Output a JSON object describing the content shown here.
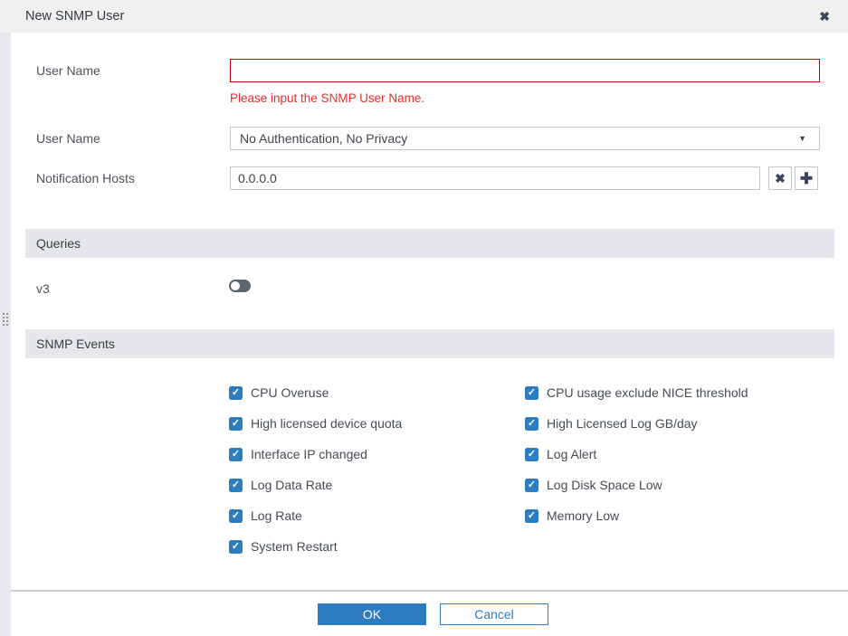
{
  "colors": {
    "accent_blue": "#2d7cc0",
    "checkbox_blue": "#2d7dc1",
    "error_text_red": "#e62e2a",
    "error_border_red": "#c40000",
    "titlebar_gray": "#f0f0f1",
    "section_bar_gray": "#e5e7ea",
    "toggle_off_gray": "#5c6470"
  },
  "icons": {
    "close": "✖",
    "plus": "✚",
    "caret_down": "▼",
    "check": "✓"
  },
  "titlebar": {
    "title": "New SNMP User"
  },
  "form": {
    "username": {
      "label": "User Name",
      "value": "",
      "error": "Please input the SNMP User Name."
    },
    "security_level": {
      "label": "User Name",
      "value": "No Authentication, No Privacy"
    },
    "notification_hosts": {
      "label": "Notification Hosts",
      "value": "0.0.0.0"
    }
  },
  "sections": {
    "queries": {
      "header": "Queries",
      "v3_label": "v3",
      "v3_enabled": false
    },
    "snmp_events": {
      "header": "SNMP Events",
      "left": [
        {
          "label": "CPU Overuse",
          "checked": true
        },
        {
          "label": "High licensed device quota",
          "checked": true
        },
        {
          "label": "Interface IP changed",
          "checked": true
        },
        {
          "label": "Log Data Rate",
          "checked": true
        },
        {
          "label": "Log Rate",
          "checked": true
        },
        {
          "label": "System Restart",
          "checked": true
        }
      ],
      "right": [
        {
          "label": "CPU usage exclude NICE threshold",
          "checked": true
        },
        {
          "label": "High Licensed Log GB/day",
          "checked": true
        },
        {
          "label": "Log Alert",
          "checked": true
        },
        {
          "label": "Log Disk Space Low",
          "checked": true
        },
        {
          "label": "Memory Low",
          "checked": true
        }
      ]
    }
  },
  "footer": {
    "ok_label": "OK",
    "cancel_label": "Cancel"
  }
}
